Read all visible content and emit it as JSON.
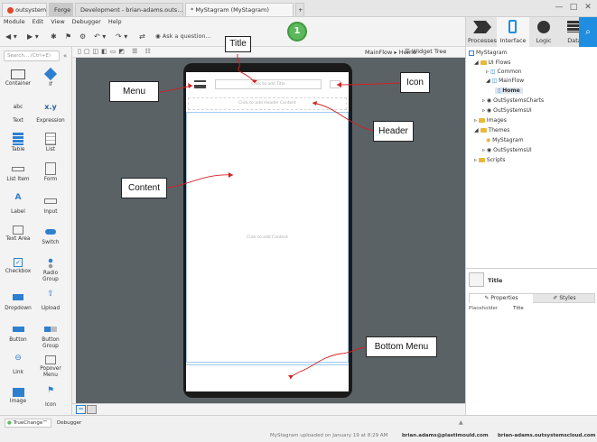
{
  "titlebar": {
    "tabs": [
      "outsystems",
      "Forge",
      "Development - brian-adams.outs...",
      "* MyStagram (MyStagram)"
    ],
    "add_tab": "+",
    "window_controls": [
      "—",
      "□",
      "✕"
    ]
  },
  "menubar": {
    "items": [
      "Module",
      "Edit",
      "View",
      "Debugger",
      "Help"
    ]
  },
  "toolbar": {
    "ask_question": "Ask a question...",
    "step_badge": "1",
    "breadcrumb": "MainFlow ▸ Home",
    "widget_tree": "Widget Tree"
  },
  "modes": {
    "items": [
      "Processes",
      "Interface",
      "Logic",
      "Data"
    ],
    "selected": "Interface"
  },
  "palette": {
    "search_placeholder": "Search... (Ctrl+E)",
    "widgets": [
      "Container",
      "If",
      "Text",
      "Expression",
      "Table",
      "List",
      "List Item",
      "Form",
      "Label",
      "Input",
      "Text Area",
      "Switch",
      "Checkbox",
      "Radio Group",
      "Dropdown",
      "Upload",
      "Button",
      "Button Group",
      "Link",
      "Popover Menu",
      "Image",
      "Icon"
    ],
    "expression_icon": "x.y",
    "text_icon": "abc"
  },
  "phone": {
    "title_placeholder": "Click to add Title",
    "header_placeholder": "Click to add Header Content",
    "content_placeholder": "Click to add Content"
  },
  "tree": {
    "items": [
      "MyStagram",
      "UI Flows",
      "Common",
      "MainFlow",
      "Home",
      "OutSystemsCharts",
      "OutSystemsUI",
      "Images",
      "Themes",
      "MyStagram",
      "OutSystemsUI",
      "Scripts"
    ]
  },
  "props": {
    "element": "Title",
    "tabs": [
      "Properties",
      "Styles"
    ],
    "row_key": "Placeholder",
    "row_value": "Title"
  },
  "statusbar": {
    "truechange": "TrueChange™",
    "debugger": "Debugger",
    "upload_msg": "MyStagram uploaded on January 19 at 8:29 AM",
    "user": "brian.adams@plastimould.com",
    "server": "brian-adams.outsystemscloud.com"
  },
  "annotations": [
    "Title",
    "Menu",
    "Icon",
    "Header",
    "Content",
    "Bottom Menu"
  ],
  "colors": {
    "accent": "#1f8ee0",
    "badge": "#5cb85c",
    "arrow": "#d42020",
    "canvas": "#5a6266"
  }
}
